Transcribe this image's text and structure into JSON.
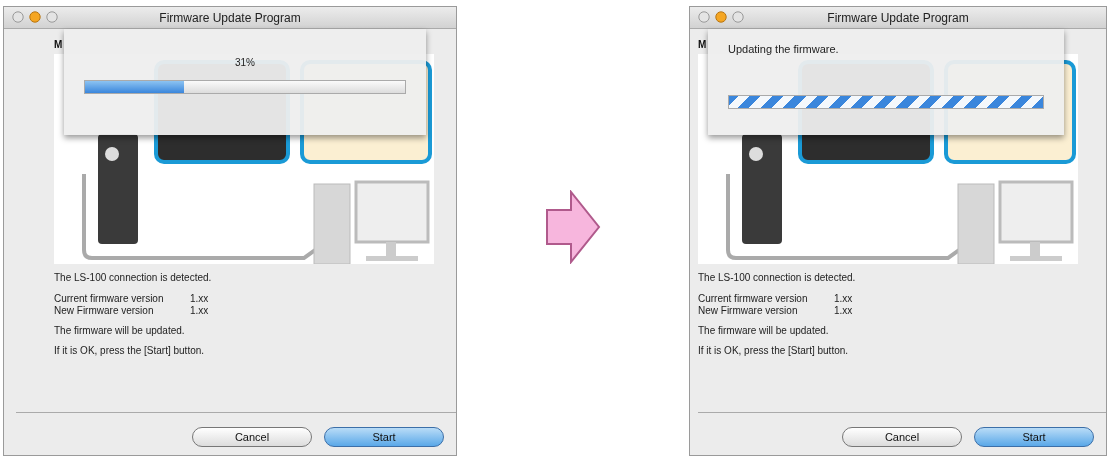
{
  "panels": [
    {
      "window": {
        "title": "Firmware Update Program"
      },
      "model_label": "M",
      "sheet": {
        "kind": "determinate",
        "text": "31%",
        "level": 0.31
      },
      "status": "The LS-100   connection is detected.",
      "versions": [
        {
          "label": "Current firmware version",
          "value": "1.xx"
        },
        {
          "label": "New Firmware version",
          "value": "1.xx"
        }
      ],
      "messages": [
        "The firmware will be updated.",
        "If it is OK, press the [Start] button."
      ],
      "buttons": [
        {
          "label": "Cancel",
          "default": false
        },
        {
          "label": "Start",
          "default": true
        }
      ]
    },
    {
      "window": {
        "title": "Firmware Update Program"
      },
      "model_label": "M",
      "sheet": {
        "kind": "indeterminate",
        "text": "Updating the firmware."
      },
      "status": "The LS-100   connection is detected.",
      "versions": [
        {
          "label": "Current firmware version",
          "value": "1.xx"
        },
        {
          "label": "New Firmware version",
          "value": "1.xx"
        }
      ],
      "messages": [
        "The firmware will be updated.",
        "If it is OK, press the [Start] button."
      ],
      "buttons": [
        {
          "label": "Cancel",
          "default": false
        },
        {
          "label": "Start",
          "default": true
        }
      ]
    }
  ]
}
